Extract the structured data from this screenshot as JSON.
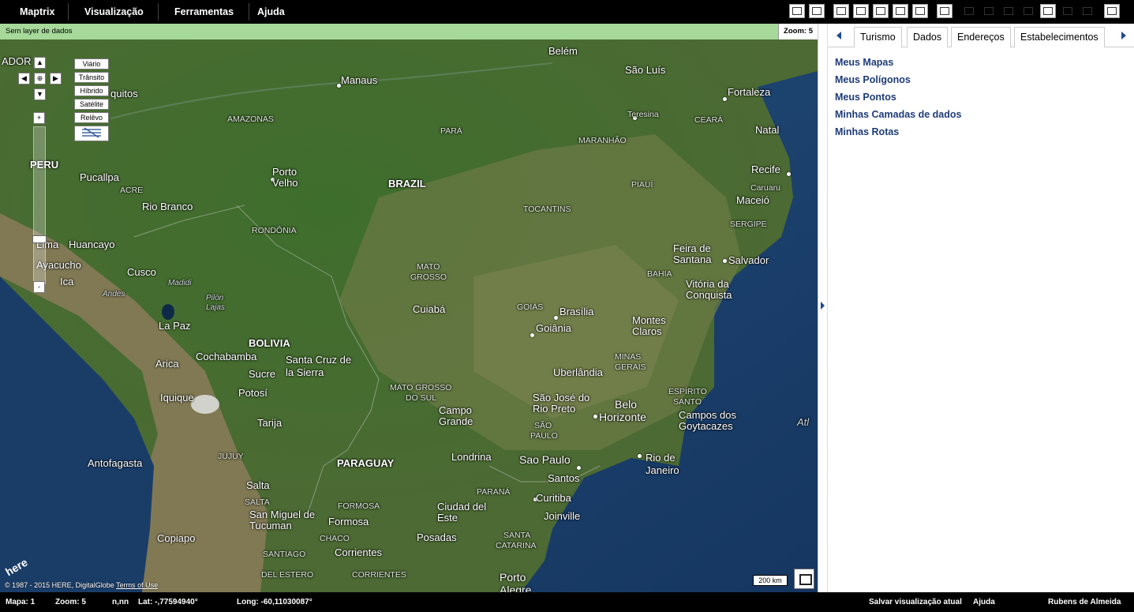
{
  "menu": {
    "items": [
      "Maptrix",
      "Visualização",
      "Ferramentas",
      "Ajuda"
    ]
  },
  "infobar": {
    "text": "Sem layer de dados",
    "zoom": "Zoom: 5"
  },
  "map": {
    "controls": {
      "up": "▲",
      "left": "◀",
      "center": "⊕",
      "right": "▶",
      "down": "▼",
      "zoom_in": "+",
      "zoom_out": "-",
      "map_types": [
        "Viário",
        "Trânsito",
        "Híbrido",
        "Satélite",
        "Relêvo"
      ]
    },
    "scale": "200 km",
    "logo": "here",
    "copyright": "© 1987 - 2015 HERE, DigitalGlobe",
    "terms": "Terms of Use",
    "labels": {
      "belem": "Belém",
      "saoluis": "São Luís",
      "manaus": "Manaus",
      "fortaleza": "Fortaleza",
      "teresina": "Teresina",
      "amazonas": "AMAZONAS",
      "para": "PARÁ",
      "ceara": "CEARÁ",
      "natal": "Natal",
      "maranhao": "MARANHÃO",
      "iquitos": "quitos",
      "ador": "ADOR",
      "peru": "PERU",
      "pucallpa": "Pucallpa",
      "acre": "ACRE",
      "portovelho1": "Porto",
      "portovelho2": "Velho",
      "brazil": "BRAZIL",
      "recife": "Recife",
      "caruaru": "Caruaru",
      "piaui": "PIAUÍ",
      "maceio": "Maceió",
      "riobranco": "Rio Branco",
      "tocantins": "TOCANTINS",
      "sergipe": "SERGIPE",
      "rondonia": "RONDÔNIA",
      "lima": "Lima",
      "huancayo": "Huancayo",
      "feira1": "Feira de",
      "feira2": "Santana",
      "salvador": "Salvador",
      "ayacucho": "Ayacucho",
      "cusco": "Cusco",
      "matogrosso1": "MATO",
      "matogrosso2": "GROSSO",
      "bahia": "BAHIA",
      "vitoria1": "Vitória da",
      "vitoria2": "Conquista",
      "ica": "Ica",
      "madidi": "Madidi",
      "andes": "Andes",
      "pilonlajas1": "Pilón",
      "pilonlajas2": "Lajas",
      "cuiaba": "Cuiabá",
      "goias": "GOIÁS",
      "brasilia": "Brasília",
      "goiania": "Goiânia",
      "montes1": "Montes",
      "montes2": "Claros",
      "lapaz": "La Paz",
      "bolivia": "BOLIVIA",
      "cochabamba": "Cochabamba",
      "santacruz1": "Santa Cruz de",
      "santacruz2": "la Sierra",
      "minas1": "MINAS",
      "minas2": "GERAIS",
      "arica": "Arica",
      "sucre": "Sucre",
      "uberlandia": "Uberlândia",
      "potosi": "Potosí",
      "msul1": "MATO GROSSO",
      "msul2": "DO SUL",
      "saojose1": "São José do",
      "saojose2": "Rio Preto",
      "belo1": "Belo",
      "belo2": "Horizonte",
      "espirito1": "ESPÍRITO",
      "espirito2": "SANTO",
      "iquique": "Iquique",
      "campogrande1": "Campo",
      "campogrande2": "Grande",
      "saopaulost1": "SÃO",
      "saopaulost2": "PAULO",
      "campos1": "Campos dos",
      "campos2": "Goytacazes",
      "tarija": "Tarija",
      "atl": "Atl",
      "jujuy": "JUJUY",
      "antofagasta": "Antofagasta",
      "paraguay": "PARAGUAY",
      "londrina": "Londrina",
      "saopaulo": "Sao Paulo",
      "riodejaneiro1": "Rio de",
      "riodejaneiro2": "Janeiro",
      "santos": "Santos",
      "salta": "Salta",
      "parana": "PARANÁ",
      "curitiba": "Curitiba",
      "saltast": "SALTA",
      "formosast": "FORMOSA",
      "ciudaddeleste1": "Ciudad del",
      "ciudaddeleste2": "Este",
      "tucuman1": "San Miguel de",
      "tucuman2": "Tucuman",
      "formosa": "Formosa",
      "joinville": "Joinville",
      "chaco": "CHACO",
      "copiapo": "Copiapo",
      "posadas": "Posadas",
      "santacatarina1": "SANTA",
      "santacatarina2": "CATARINA",
      "santiagodelestero1": "SANTIAGO",
      "santiagodelestero2": "DEL ESTERO",
      "corrientes": "Corrientes",
      "corrientesst": "CORRIENTES",
      "portoalegre1": "Porto",
      "portoalegre2": "Alegre"
    }
  },
  "panel": {
    "tabs": [
      "Turismo",
      "Dados",
      "Endereços",
      "Estabelecimentos"
    ],
    "links": [
      "Meus Mapas",
      "Meus Polígonos",
      "Meus Pontos",
      "Minhas Camadas de dados",
      "Minhas Rotas"
    ]
  },
  "status": {
    "mapa": "Mapa: 1",
    "zoom": "Zoom: 5",
    "nn": "n,nn",
    "lat": "Lat: -,77594940°",
    "long": "Long: -60,11030087°",
    "save": "Salvar visualização atual",
    "help": "Ajuda",
    "user": "Rubens de Almeida"
  },
  "colors": {
    "ocean": "#1e4470",
    "forest": "#3d6a2d",
    "savanna": "#6f7a4a",
    "andes": "#8a7a5c",
    "infobar": "#a6d99a",
    "link": "#1e3c78"
  }
}
